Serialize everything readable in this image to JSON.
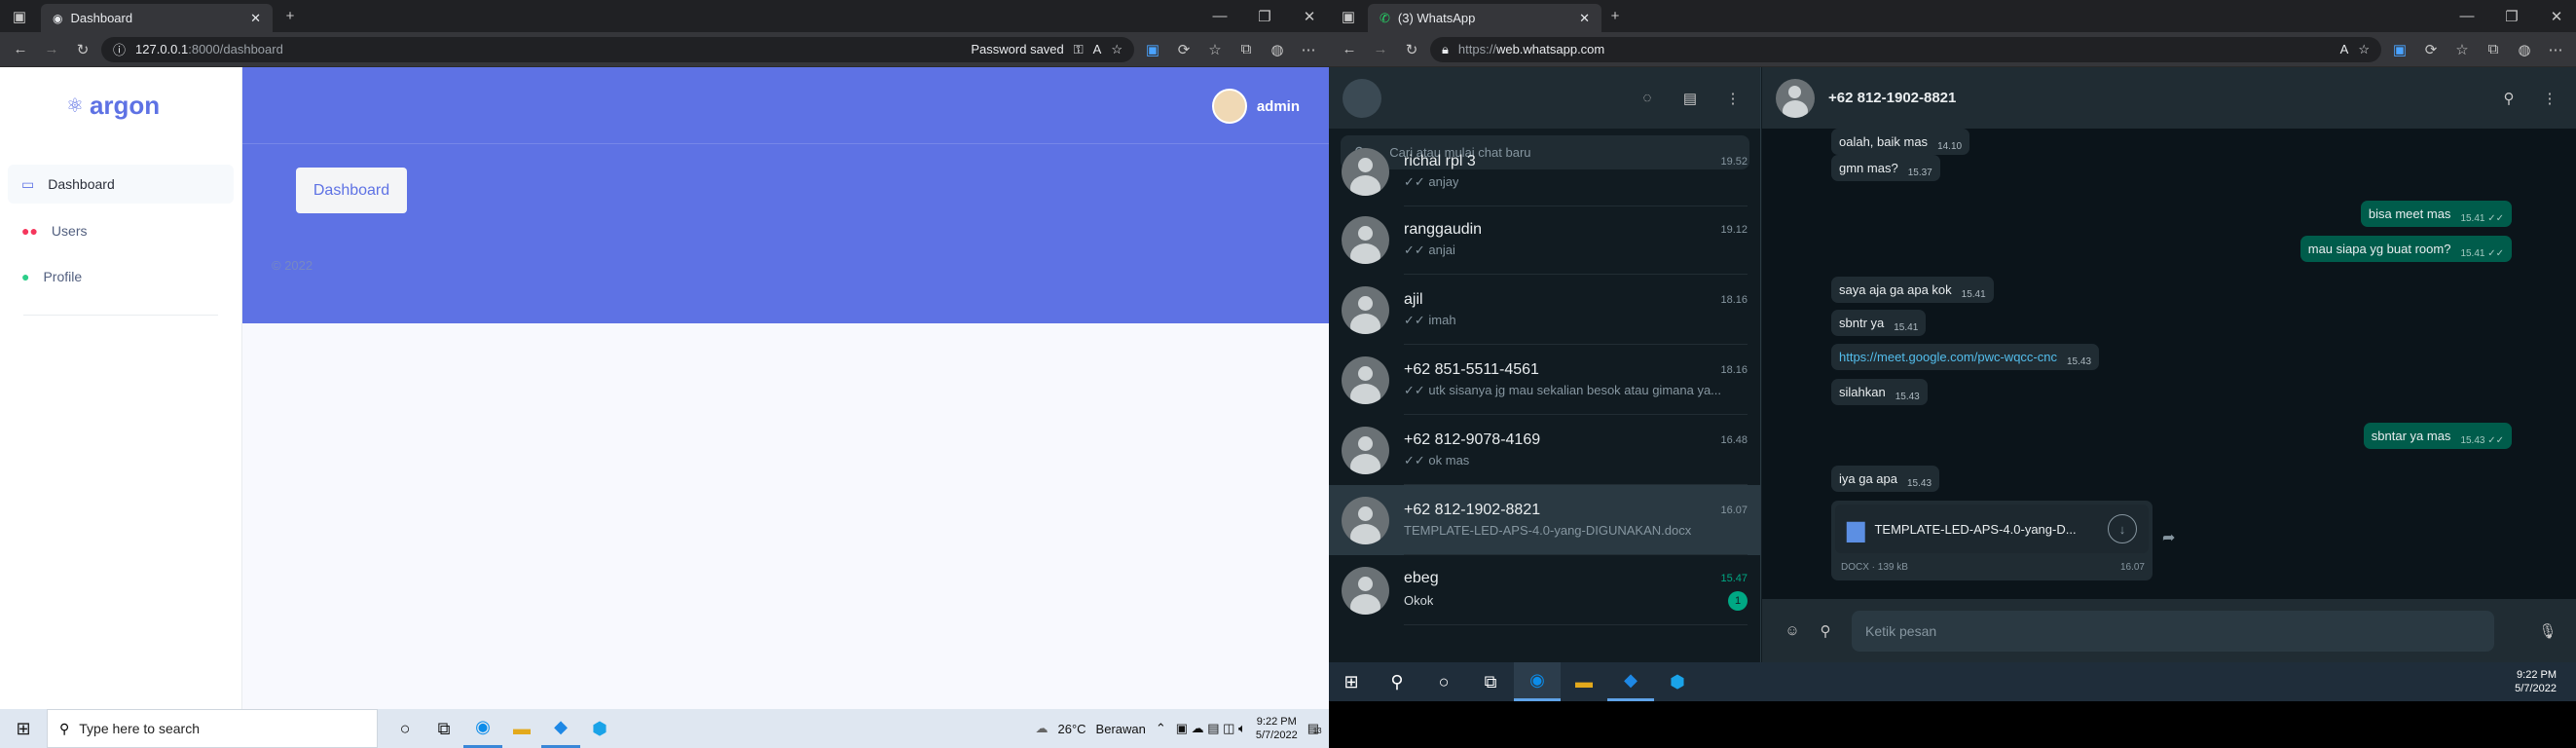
{
  "left_browser": {
    "tab_title": "Dashboard",
    "url_host": "127.0.0.1",
    "url_rest": ":8000/dashboard",
    "password_saved": "Password saved"
  },
  "argon": {
    "brand": "argon",
    "nav": [
      {
        "label": "Dashboard",
        "icon": "monitor-icon",
        "color": "#5e72e4"
      },
      {
        "label": "Users",
        "icon": "users-icon",
        "color": "#f5365c"
      },
      {
        "label": "Profile",
        "icon": "user-icon",
        "color": "#2dce89"
      }
    ],
    "header_color": "#5e72e4",
    "user": "admin",
    "breadcrumb_button": "Dashboard",
    "copyright": "© 2022"
  },
  "left_taskbar": {
    "search_placeholder": "Type here to search",
    "weather_temp": "26°C",
    "weather_desc": "Berawan",
    "time": "9:22 PM",
    "date": "5/7/2022",
    "notif_count": "13"
  },
  "right_browser": {
    "tab_title": "(3) WhatsApp",
    "url_scheme": "https://",
    "url_host": "web.whatsapp.com"
  },
  "whatsapp": {
    "search_placeholder": "Cari atau mulai chat baru",
    "chats": [
      {
        "name": "richal rpl 3",
        "time": "19.52",
        "preview": "✓✓ anjay"
      },
      {
        "name": "ranggaudin",
        "time": "19.12",
        "preview": "✓✓ anjai"
      },
      {
        "name": "ajil",
        "time": "18.16",
        "preview": "✓✓ imah"
      },
      {
        "name": "+62 851-5511-4561",
        "time": "18.16",
        "preview": "✓✓ utk sisanya jg mau sekalian besok atau gimana ya..."
      },
      {
        "name": "+62 812-9078-4169",
        "time": "16.48",
        "preview": "✓✓ ok mas"
      },
      {
        "name": "+62 812-1902-8821",
        "time": "16.07",
        "preview": "TEMPLATE-LED-APS-4.0-yang-DIGUNAKAN.docx"
      },
      {
        "name": "ebeg",
        "time": "15.47",
        "preview": "Okok",
        "unread": "1"
      }
    ],
    "active_chat": "+62 812-1902-8821",
    "messages": [
      {
        "text": "oalah, baik mas",
        "time": "14.10",
        "dir": "in"
      },
      {
        "text": "gmn mas?",
        "time": "15.37",
        "dir": "in"
      },
      {
        "text": "bisa meet mas",
        "time": "15.41 ✓✓",
        "dir": "out"
      },
      {
        "text": "mau siapa yg buat room?",
        "time": "15.41 ✓✓",
        "dir": "out"
      },
      {
        "text": "saya aja ga apa kok",
        "time": "15.41",
        "dir": "in"
      },
      {
        "text": "sbntr ya",
        "time": "15.41",
        "dir": "in"
      },
      {
        "text": "https://meet.google.com/pwc-wqcc-cnc",
        "time": "15.43",
        "dir": "in",
        "link": true
      },
      {
        "text": "silahkan",
        "time": "15.43",
        "dir": "in"
      },
      {
        "text": "sbntar ya mas",
        "time": "15.43 ✓✓",
        "dir": "out"
      },
      {
        "text": "iya ga apa",
        "time": "15.43",
        "dir": "in"
      }
    ],
    "doc": {
      "name": "TEMPLATE-LED-APS-4.0-yang-D...",
      "meta": "DOCX · 139 kB",
      "time": "16.07"
    },
    "input_placeholder": "Ketik pesan"
  },
  "right_taskbar": {
    "time": "9:22 PM",
    "date": "5/7/2022"
  }
}
